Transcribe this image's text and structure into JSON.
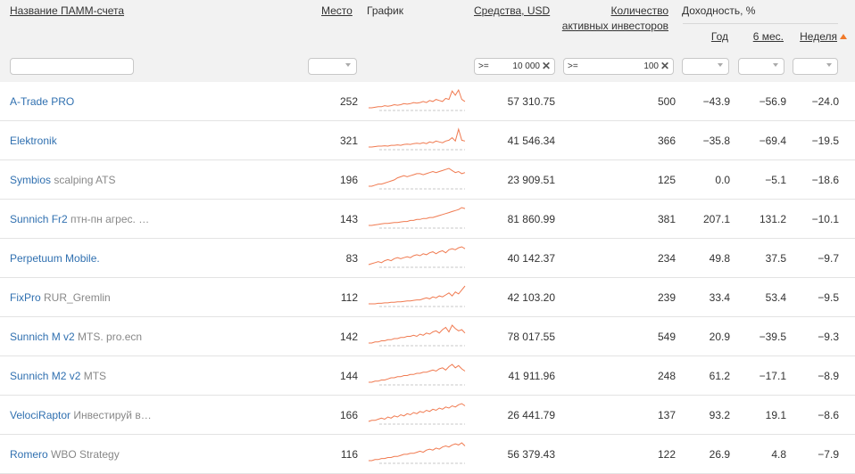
{
  "header": {
    "name": "Название ПАММ-счета",
    "place": "Место",
    "chart": "График",
    "funds": "Средства, USD",
    "investors_l1": "Количество",
    "investors_l2": "активных инвесторов",
    "yield": "Доходность, %",
    "year": "Год",
    "six_months": "6 мес.",
    "week": "Неделя"
  },
  "filters": {
    "name_value": "",
    "funds_op": ">=",
    "funds_value": "10 000",
    "investors_op": ">=",
    "investors_value": "100"
  },
  "colors": {
    "link": "#3070b0",
    "spark": "#f07a50",
    "sort_arrow": "#f07a2a"
  },
  "rows": [
    {
      "name": "A-Trade PRO",
      "sub": "",
      "place": "252",
      "funds": "57 310.75",
      "investors": "500",
      "year": "−43.9",
      "six": "−56.9",
      "week": "−24.0",
      "spark": [
        6,
        6,
        6.5,
        7,
        7,
        8,
        7.5,
        8,
        9,
        8.5,
        9,
        10,
        9.5,
        10,
        11,
        10.5,
        11,
        12,
        11,
        13,
        12,
        14,
        13,
        12,
        15,
        14,
        22,
        18,
        23,
        14,
        12
      ]
    },
    {
      "name": "Elektronik",
      "sub": "",
      "place": "321",
      "funds": "41 546.34",
      "investors": "366",
      "year": "−35.8",
      "six": "−69.4",
      "week": "−19.5",
      "spark": [
        5,
        5,
        5.5,
        6,
        6,
        6.5,
        6,
        7,
        7,
        7.5,
        7,
        8,
        8.5,
        8,
        9,
        9.5,
        9,
        10,
        9,
        11,
        10,
        12,
        11,
        10,
        12,
        13,
        16,
        12,
        26,
        13,
        12
      ]
    },
    {
      "name": "Symbios",
      "sub": "scalping ATS",
      "place": "196",
      "funds": "23 909.51",
      "investors": "125",
      "year": "0.0",
      "six": "−5.1",
      "week": "−18.6",
      "spark": [
        6,
        6,
        7,
        8,
        8,
        9,
        10,
        11,
        12,
        14,
        15,
        16,
        15,
        16,
        17,
        18,
        18,
        17,
        18,
        19,
        20,
        19,
        20,
        21,
        22,
        23,
        21,
        19,
        20,
        18,
        19
      ]
    },
    {
      "name": "Sunnich Fr2",
      "sub": "птн-пн агрес. …",
      "place": "143",
      "funds": "81 860.99",
      "investors": "381",
      "year": "207.1",
      "six": "131.2",
      "week": "−10.1",
      "spark": [
        6,
        6,
        6.5,
        7,
        7.5,
        8,
        8,
        8.5,
        9,
        9,
        9.5,
        10,
        10,
        11,
        11,
        12,
        12,
        13,
        13,
        14,
        14,
        15,
        16,
        17,
        18,
        19,
        20,
        21,
        22,
        24,
        23
      ]
    },
    {
      "name": "Perpetuum Mobile.",
      "sub": "",
      "place": "83",
      "funds": "40 142.37",
      "investors": "234",
      "year": "49.8",
      "six": "37.5",
      "week": "−9.7",
      "spark": [
        6,
        7,
        8,
        9,
        8,
        10,
        11,
        10,
        12,
        13,
        12,
        13,
        14,
        13,
        15,
        16,
        15,
        17,
        16,
        18,
        19,
        17,
        19,
        20,
        18,
        21,
        22,
        21,
        23,
        24,
        22
      ]
    },
    {
      "name": "FixPro",
      "sub": "RUR_Gremlin",
      "place": "112",
      "funds": "42 103.20",
      "investors": "239",
      "year": "33.4",
      "six": "53.4",
      "week": "−9.5",
      "spark": [
        6,
        6,
        6,
        6.5,
        6.5,
        7,
        7,
        7.5,
        7.5,
        8,
        8,
        8.5,
        9,
        9,
        9.5,
        10,
        10,
        11,
        12,
        11,
        13,
        12,
        14,
        13,
        15,
        17,
        14,
        18,
        16,
        20,
        24
      ]
    },
    {
      "name": "Sunnich M v2",
      "sub": "MTS. pro.ecn",
      "place": "142",
      "funds": "78 017.55",
      "investors": "549",
      "year": "20.9",
      "six": "−39.5",
      "week": "−9.3",
      "spark": [
        6,
        6,
        7,
        7,
        8,
        8,
        9,
        9,
        10,
        10,
        11,
        11,
        12,
        12,
        13,
        12,
        14,
        13,
        15,
        14,
        16,
        17,
        15,
        18,
        20,
        16,
        22,
        19,
        17,
        18,
        15
      ]
    },
    {
      "name": "Sunnich M2 v2",
      "sub": "MTS",
      "place": "144",
      "funds": "41 911.96",
      "investors": "248",
      "year": "61.2",
      "six": "−17.1",
      "week": "−8.9",
      "spark": [
        6,
        6,
        7,
        7,
        8,
        8,
        9,
        10,
        10,
        11,
        11,
        12,
        12,
        13,
        13,
        14,
        14,
        15,
        15,
        16,
        17,
        16,
        18,
        19,
        17,
        20,
        22,
        19,
        21,
        18,
        16
      ]
    },
    {
      "name": "VelociRaptor",
      "sub": "Инвестируй в…",
      "place": "166",
      "funds": "26 441.79",
      "investors": "137",
      "year": "93.2",
      "six": "19.1",
      "week": "−8.6",
      "spark": [
        6,
        7,
        7,
        8,
        9,
        8,
        10,
        9,
        11,
        10,
        12,
        11,
        13,
        12,
        14,
        13,
        15,
        14,
        16,
        15,
        17,
        16,
        18,
        17,
        19,
        18,
        20,
        19,
        21,
        22,
        20
      ]
    },
    {
      "name": "Romero",
      "sub": "WBO Strategy",
      "place": "116",
      "funds": "56 379.43",
      "investors": "122",
      "year": "26.9",
      "six": "4.8",
      "week": "−7.9",
      "spark": [
        6,
        6,
        7,
        7,
        8,
        8,
        9,
        9,
        10,
        10,
        11,
        12,
        12,
        13,
        13,
        14,
        15,
        14,
        16,
        17,
        16,
        18,
        17,
        19,
        20,
        19,
        21,
        22,
        21,
        23,
        20
      ]
    }
  ]
}
